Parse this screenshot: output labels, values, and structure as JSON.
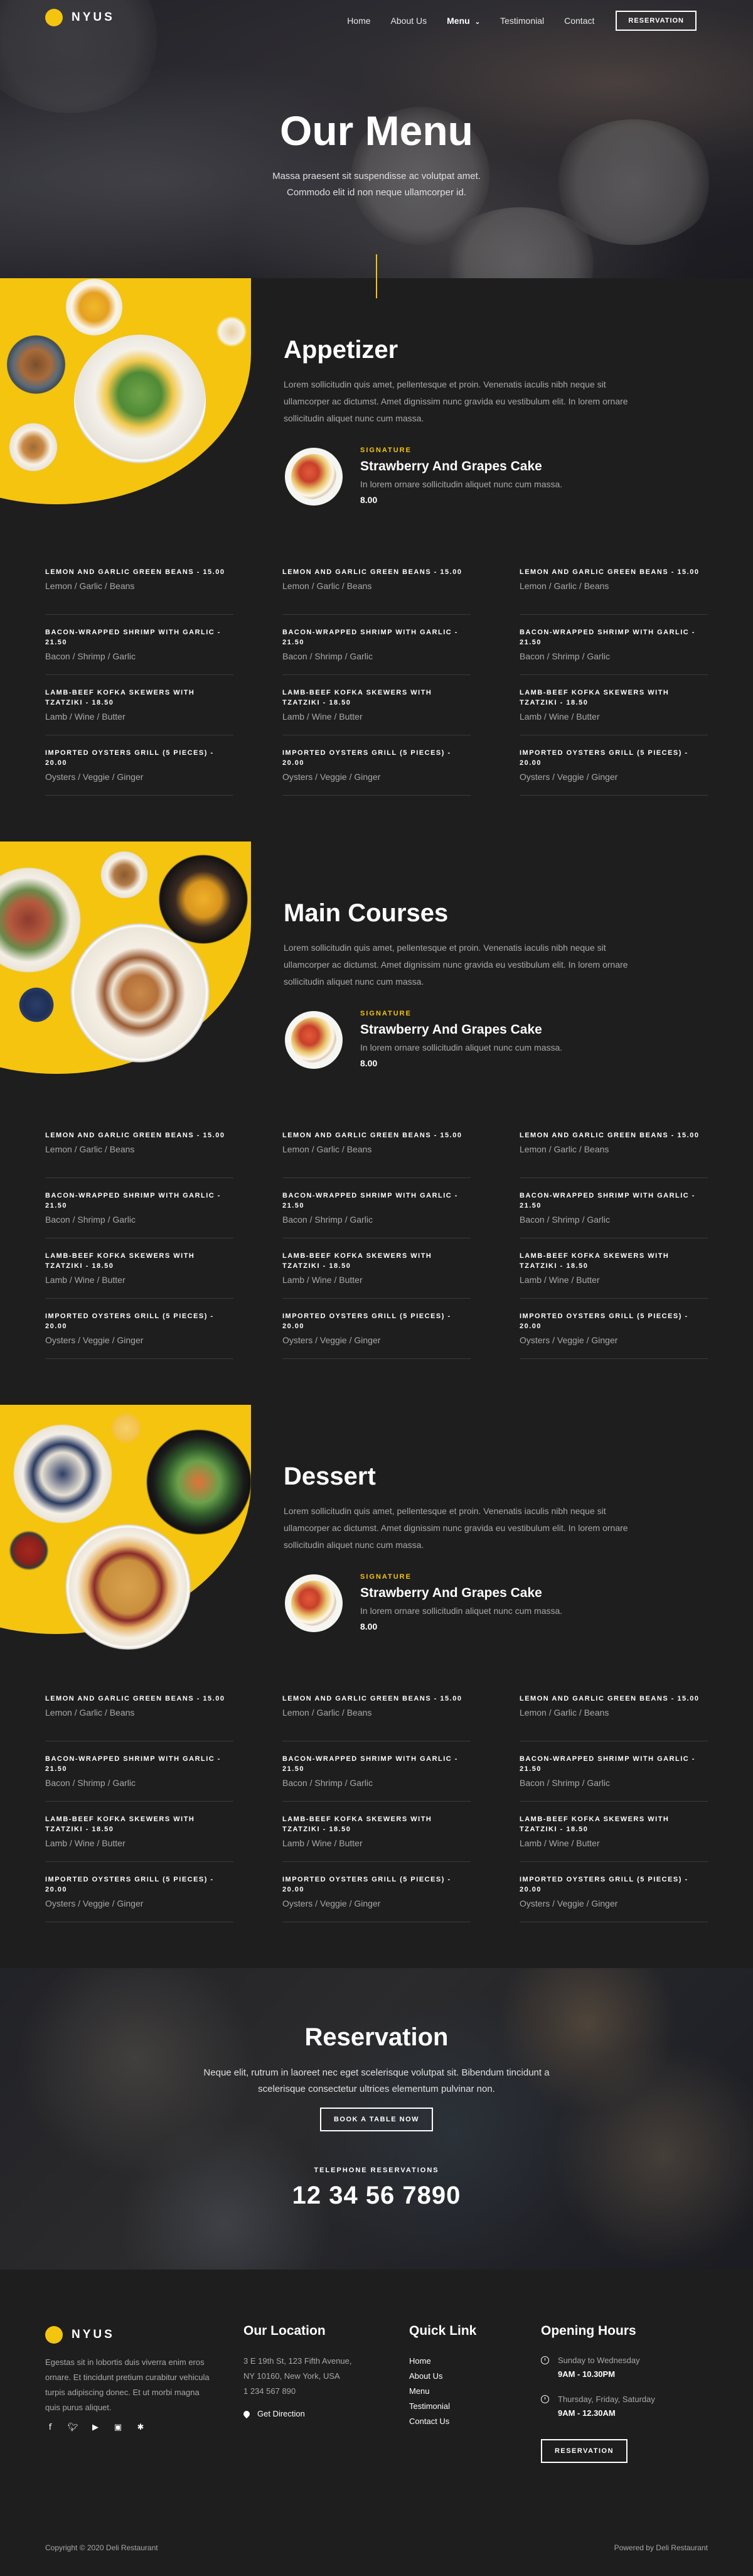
{
  "brand": {
    "name": "NYUS",
    "accent": "#f4c40f",
    "background": "#1e1e1e"
  },
  "nav": {
    "items": [
      "Home",
      "About Us",
      "Menu",
      "Testimonial",
      "Contact"
    ],
    "active": "Menu",
    "reservation_button": "RESERVATION"
  },
  "hero": {
    "title": "Our Menu",
    "subtitle": "Massa praesent sit suspendisse ac volutpat amet. Commodo elit id non neque ullamcorper id."
  },
  "sections": [
    {
      "title": "Appetizer",
      "description": "Lorem sollicitudin quis amet, pellentesque et proin. Venenatis iaculis nibh neque sit ullamcorper ac dictumst. Amet dignissim nunc gravida eu vestibulum elit. In lorem ornare sollicitudin aliquet nunc cum massa.",
      "signature": {
        "label": "SIGNATURE",
        "name": "Strawberry And Grapes Cake",
        "description": "In lorem ornare sollicitudin aliquet nunc cum massa.",
        "price": "8.00"
      },
      "items": [
        {
          "name": "LEMON AND GARLIC GREEN BEANS - 15.00",
          "desc": "Lemon / Garlic / Beans"
        },
        {
          "name": "LEMON AND GARLIC GREEN BEANS - 15.00",
          "desc": "Lemon / Garlic / Beans"
        },
        {
          "name": "LEMON AND GARLIC GREEN BEANS - 15.00",
          "desc": "Lemon / Garlic / Beans"
        },
        {
          "name": "BACON-WRAPPED SHRIMP WITH GARLIC - 21.50",
          "desc": "Bacon / Shrimp / Garlic"
        },
        {
          "name": "BACON-WRAPPED SHRIMP WITH GARLIC - 21.50",
          "desc": "Bacon / Shrimp / Garlic"
        },
        {
          "name": "BACON-WRAPPED SHRIMP WITH GARLIC - 21.50",
          "desc": "Bacon / Shrimp / Garlic"
        },
        {
          "name": "LAMB-BEEF KOFKA SKEWERS WITH TZATZIKI - 18.50",
          "desc": "Lamb / Wine / Butter"
        },
        {
          "name": "LAMB-BEEF KOFKA SKEWERS WITH TZATZIKI - 18.50",
          "desc": "Lamb / Wine / Butter"
        },
        {
          "name": "LAMB-BEEF KOFKA SKEWERS WITH TZATZIKI - 18.50",
          "desc": "Lamb / Wine / Butter"
        },
        {
          "name": "IMPORTED OYSTERS GRILL (5 PIECES) - 20.00",
          "desc": "Oysters / Veggie / Ginger"
        },
        {
          "name": "IMPORTED OYSTERS GRILL (5 PIECES) - 20.00",
          "desc": "Oysters / Veggie / Ginger"
        },
        {
          "name": "IMPORTED OYSTERS GRILL (5 PIECES) - 20.00",
          "desc": "Oysters / Veggie / Ginger"
        }
      ]
    },
    {
      "title": "Main Courses",
      "description": "Lorem sollicitudin quis amet, pellentesque et proin. Venenatis iaculis nibh neque sit ullamcorper ac dictumst. Amet dignissim nunc gravida eu vestibulum elit. In lorem ornare sollicitudin aliquet nunc cum massa.",
      "signature": {
        "label": "SIGNATURE",
        "name": "Strawberry And Grapes Cake",
        "description": "In lorem ornare sollicitudin aliquet nunc cum massa.",
        "price": "8.00"
      },
      "items": [
        {
          "name": "LEMON AND GARLIC GREEN BEANS - 15.00",
          "desc": "Lemon / Garlic / Beans"
        },
        {
          "name": "LEMON AND GARLIC GREEN BEANS - 15.00",
          "desc": "Lemon / Garlic / Beans"
        },
        {
          "name": "LEMON AND GARLIC GREEN BEANS - 15.00",
          "desc": "Lemon / Garlic / Beans"
        },
        {
          "name": "BACON-WRAPPED SHRIMP WITH GARLIC - 21.50",
          "desc": "Bacon / Shrimp / Garlic"
        },
        {
          "name": "BACON-WRAPPED SHRIMP WITH GARLIC - 21.50",
          "desc": "Bacon / Shrimp / Garlic"
        },
        {
          "name": "BACON-WRAPPED SHRIMP WITH GARLIC - 21.50",
          "desc": "Bacon / Shrimp / Garlic"
        },
        {
          "name": "LAMB-BEEF KOFKA SKEWERS WITH TZATZIKI - 18.50",
          "desc": "Lamb / Wine / Butter"
        },
        {
          "name": "LAMB-BEEF KOFKA SKEWERS WITH TZATZIKI - 18.50",
          "desc": "Lamb / Wine / Butter"
        },
        {
          "name": "LAMB-BEEF KOFKA SKEWERS WITH TZATZIKI - 18.50",
          "desc": "Lamb / Wine / Butter"
        },
        {
          "name": "IMPORTED OYSTERS GRILL (5 PIECES) - 20.00",
          "desc": "Oysters / Veggie / Ginger"
        },
        {
          "name": "IMPORTED OYSTERS GRILL (5 PIECES) - 20.00",
          "desc": "Oysters / Veggie / Ginger"
        },
        {
          "name": "IMPORTED OYSTERS GRILL (5 PIECES) - 20.00",
          "desc": "Oysters / Veggie / Ginger"
        }
      ]
    },
    {
      "title": "Dessert",
      "description": "Lorem sollicitudin quis amet, pellentesque et proin. Venenatis iaculis nibh neque sit ullamcorper ac dictumst. Amet dignissim nunc gravida eu vestibulum elit. In lorem ornare sollicitudin aliquet nunc cum massa.",
      "signature": {
        "label": "SIGNATURE",
        "name": "Strawberry And Grapes Cake",
        "description": "In lorem ornare sollicitudin aliquet nunc cum massa.",
        "price": "8.00"
      },
      "items": [
        {
          "name": "LEMON AND GARLIC GREEN BEANS - 15.00",
          "desc": "Lemon / Garlic / Beans"
        },
        {
          "name": "LEMON AND GARLIC GREEN BEANS - 15.00",
          "desc": "Lemon / Garlic / Beans"
        },
        {
          "name": "LEMON AND GARLIC GREEN BEANS - 15.00",
          "desc": "Lemon / Garlic / Beans"
        },
        {
          "name": "BACON-WRAPPED SHRIMP WITH GARLIC - 21.50",
          "desc": "Bacon / Shrimp / Garlic"
        },
        {
          "name": "BACON-WRAPPED SHRIMP WITH GARLIC - 21.50",
          "desc": "Bacon / Shrimp / Garlic"
        },
        {
          "name": "BACON-WRAPPED SHRIMP WITH GARLIC - 21.50",
          "desc": "Bacon / Shrimp / Garlic"
        },
        {
          "name": "LAMB-BEEF KOFKA SKEWERS WITH TZATZIKI - 18.50",
          "desc": "Lamb / Wine / Butter"
        },
        {
          "name": "LAMB-BEEF KOFKA SKEWERS WITH TZATZIKI - 18.50",
          "desc": "Lamb / Wine / Butter"
        },
        {
          "name": "LAMB-BEEF KOFKA SKEWERS WITH TZATZIKI - 18.50",
          "desc": "Lamb / Wine / Butter"
        },
        {
          "name": "IMPORTED OYSTERS GRILL (5 PIECES) - 20.00",
          "desc": "Oysters / Veggie / Ginger"
        },
        {
          "name": "IMPORTED OYSTERS GRILL (5 PIECES) - 20.00",
          "desc": "Oysters / Veggie / Ginger"
        },
        {
          "name": "IMPORTED OYSTERS GRILL (5 PIECES) - 20.00",
          "desc": "Oysters / Veggie / Ginger"
        }
      ]
    }
  ],
  "reservation": {
    "title": "Reservation",
    "subtitle": "Neque elit, rutrum in laoreet nec eget scelerisque volutpat sit. Bibendum tincidunt a scelerisque consectetur ultrices elementum pulvinar non.",
    "button": "BOOK A TABLE NOW",
    "phone_label": "TELEPHONE RESERVATIONS",
    "phone": "12 34 56 7890"
  },
  "footer": {
    "about": "Egestas sit in lobortis duis viverra enim eros ornare. Et tincidunt pretium curabitur vehicula turpis adipiscing donec. Et ut morbi magna quis purus aliquet.",
    "socials": [
      "facebook-icon",
      "twitter-icon",
      "youtube-icon",
      "instagram-icon",
      "yelp-icon"
    ],
    "location": {
      "heading": "Our Location",
      "lines": [
        "3 E 19th St, 123 Fifth Avenue,",
        "NY 10160, New York, USA",
        "1 234 567 890"
      ],
      "direction": "Get Direction"
    },
    "quick_link": {
      "heading": "Quick Link",
      "links": [
        "Home",
        "About Us",
        "Menu",
        "Testimonial",
        "Contact Us"
      ]
    },
    "hours": {
      "heading": "Opening Hours",
      "rows": [
        {
          "day": "Sunday to Wednesday",
          "time": "9AM - 10.30PM"
        },
        {
          "day": "Thursday, Friday, Saturday",
          "time": "9AM - 12.30AM"
        }
      ],
      "button": "RESERVATION"
    },
    "copyright": "Copyright © 2020 Deli Restaurant",
    "powered": "Powered by Deli Restaurant"
  }
}
